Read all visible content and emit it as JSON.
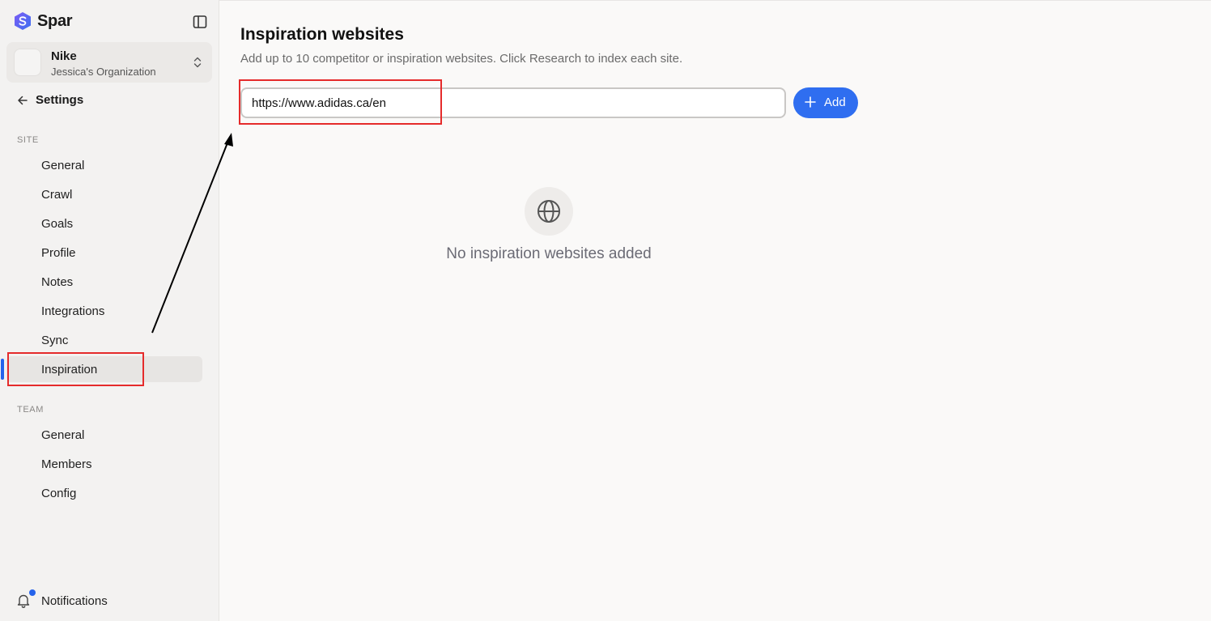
{
  "brand": {
    "name": "Spar",
    "accent": "#2563eb"
  },
  "org": {
    "name": "Nike",
    "subtitle": "Jessica's Organization"
  },
  "settings": {
    "back_label": "Settings"
  },
  "sidebar": {
    "site_label": "SITE",
    "site_items": [
      {
        "label": "General"
      },
      {
        "label": "Crawl"
      },
      {
        "label": "Goals"
      },
      {
        "label": "Profile"
      },
      {
        "label": "Notes"
      },
      {
        "label": "Integrations"
      },
      {
        "label": "Sync"
      },
      {
        "label": "Inspiration",
        "active": true
      }
    ],
    "team_label": "TEAM",
    "team_items": [
      {
        "label": "General"
      },
      {
        "label": "Members"
      },
      {
        "label": "Config"
      }
    ],
    "notifications_label": "Notifications"
  },
  "main": {
    "title": "Inspiration websites",
    "description": "Add up to 10 competitor or inspiration websites. Click Research to index each site.",
    "url_input": {
      "value": "https://www.adidas.ca/en"
    },
    "add_label": "Add",
    "empty_text": "No inspiration websites added",
    "empty_icon": "globe-icon"
  },
  "annotations": {
    "highlight_color": "#e52b2b",
    "arrow_color": "#000000"
  }
}
